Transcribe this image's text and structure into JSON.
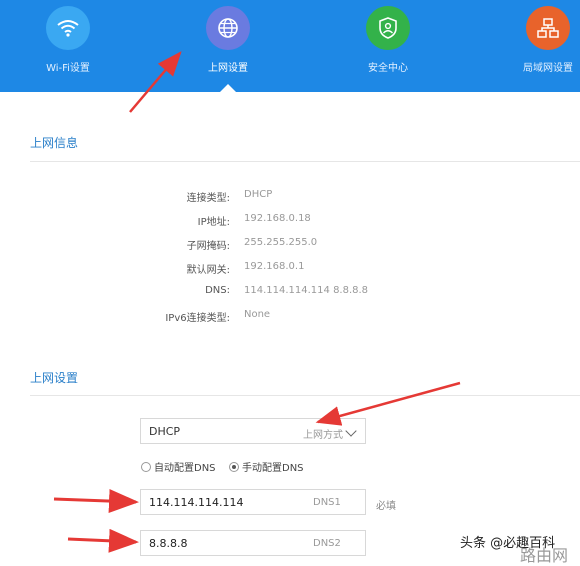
{
  "nav": [
    {
      "label": "Wi-Fi设置",
      "icon": "wifi-icon",
      "color": "#3aa8f2"
    },
    {
      "label": "上网设置",
      "icon": "globe-icon",
      "color": "#6a7be0"
    },
    {
      "label": "安全中心",
      "icon": "shield-icon",
      "color": "#33b24a"
    },
    {
      "label": "局域网设置",
      "icon": "network-icon",
      "color": "#e8632b"
    }
  ],
  "info": {
    "title": "上网信息",
    "rows": [
      {
        "key": "连接类型:",
        "value": "DHCP"
      },
      {
        "key": "IP地址:",
        "value": "192.168.0.18"
      },
      {
        "key": "子网掩码:",
        "value": "255.255.255.0"
      },
      {
        "key": "默认网关:",
        "value": "192.168.0.1"
      },
      {
        "key": "DNS:",
        "value": "114.114.114.114 8.8.8.8"
      },
      {
        "key": "IPv6连接类型:",
        "value": "None"
      }
    ]
  },
  "settings": {
    "title": "上网设置",
    "mode_value": "DHCP",
    "mode_hint": "上网方式",
    "dns_auto_label": "自动配置DNS",
    "dns_manual_label": "手动配置DNS",
    "dns_manual_selected": true,
    "dns1_value": "114.114.114.114",
    "dns1_suffix": "DNS1",
    "dns1_required": "必填",
    "dns2_value": "8.8.8.8",
    "dns2_suffix": "DNS2"
  },
  "watermark": {
    "text1": "头条 @必趣百科",
    "text2": "路由网"
  },
  "colors": {
    "topbar": "#1e88e5",
    "accent_title": "#2a7fc9",
    "arrow": "#e53935"
  }
}
